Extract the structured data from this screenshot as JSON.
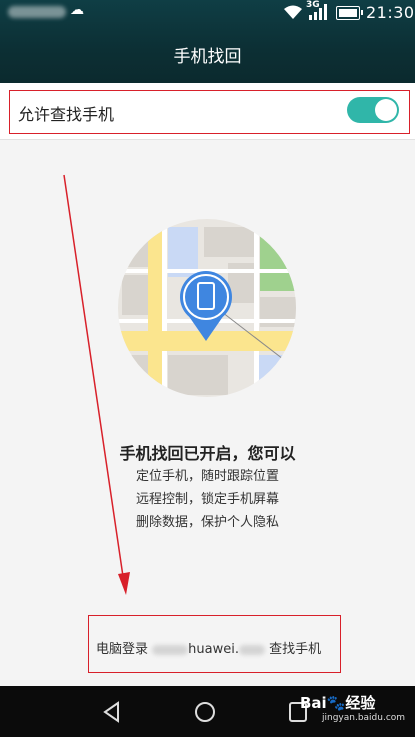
{
  "status_bar": {
    "time": "21:30",
    "network": "3G"
  },
  "header": {
    "title": "手机找回"
  },
  "setting": {
    "label": "允许查找手机",
    "enabled": true,
    "toggle_color": "#30b6a9"
  },
  "main": {
    "headline": "手机找回已开启，您可以",
    "features": [
      "定位手机，随时跟踪位置",
      "远程控制，锁定手机屏幕",
      "删除数据，保护个人隐私"
    ]
  },
  "footer_link": {
    "prefix": "电脑登录",
    "domain": "huawei.",
    "suffix": "查找手机"
  },
  "watermark": {
    "brand": "Bai",
    "brand_suffix": "经验",
    "url": "jingyan.baidu.com"
  },
  "colors": {
    "header_bg": "#0f3e45",
    "accent": "#30b6a9",
    "annotation": "#d8202a"
  }
}
